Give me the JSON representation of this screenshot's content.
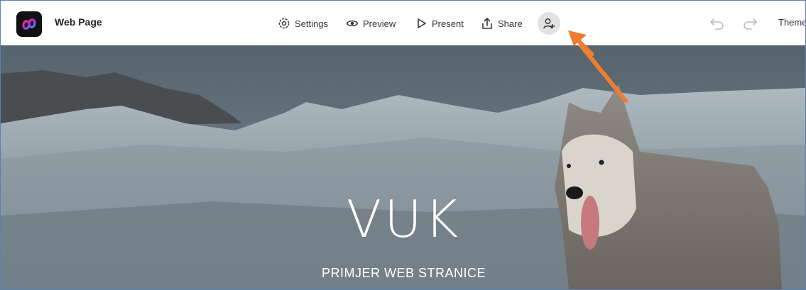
{
  "app": {
    "logo_icon": "creative-cloud-express-icon",
    "document_title": "Web Page"
  },
  "toolbar": {
    "settings_label": "Settings",
    "preview_label": "Preview",
    "present_label": "Present",
    "share_label": "Share",
    "invite_icon": "add-person-icon",
    "undo_icon": "undo-icon",
    "redo_icon": "redo-icon",
    "themes_label": "Themes"
  },
  "hero": {
    "title": "VUK",
    "subtitle": "PRIMJER WEB STRANICE",
    "background": "glacier landscape with husky dog"
  },
  "annotation": {
    "arrow_color": "#ef7d2f"
  },
  "colors": {
    "toolbar_bg": "#ffffff",
    "invite_bg": "#e2e2e2"
  }
}
